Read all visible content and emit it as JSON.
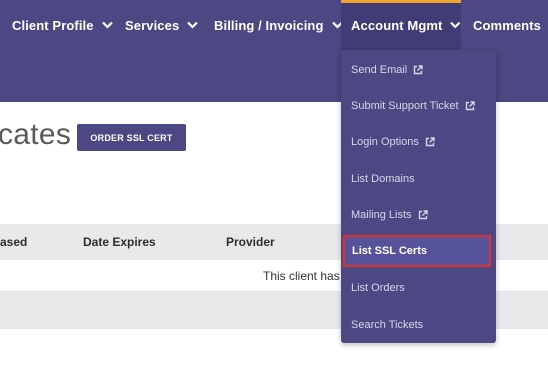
{
  "nav": {
    "items": [
      {
        "label": "Client Profile"
      },
      {
        "label": "Services"
      },
      {
        "label": "Billing / Invoicing"
      },
      {
        "label": "Account Mgmt"
      },
      {
        "label": "Comments"
      }
    ]
  },
  "page": {
    "title": "cates",
    "order_button": "ORDER SSL CERT"
  },
  "table": {
    "columns": [
      "ased",
      "Date Expires",
      "Provider"
    ],
    "empty_message": "This client has"
  },
  "dropdown": {
    "items": [
      {
        "label": "Send Email",
        "external": true
      },
      {
        "label": "Submit Support Ticket",
        "external": true
      },
      {
        "label": "Login Options",
        "external": true
      },
      {
        "label": "List Domains",
        "external": false
      },
      {
        "label": "Mailing Lists",
        "external": true
      },
      {
        "label": "List SSL Certs",
        "external": false,
        "highlighted": true
      },
      {
        "label": "List Orders",
        "external": false
      },
      {
        "label": "Search Tickets",
        "external": false
      }
    ]
  },
  "colors": {
    "nav_bg": "#4b4883",
    "active_accent": "#f0a42d",
    "highlight_border": "#e0322a"
  }
}
